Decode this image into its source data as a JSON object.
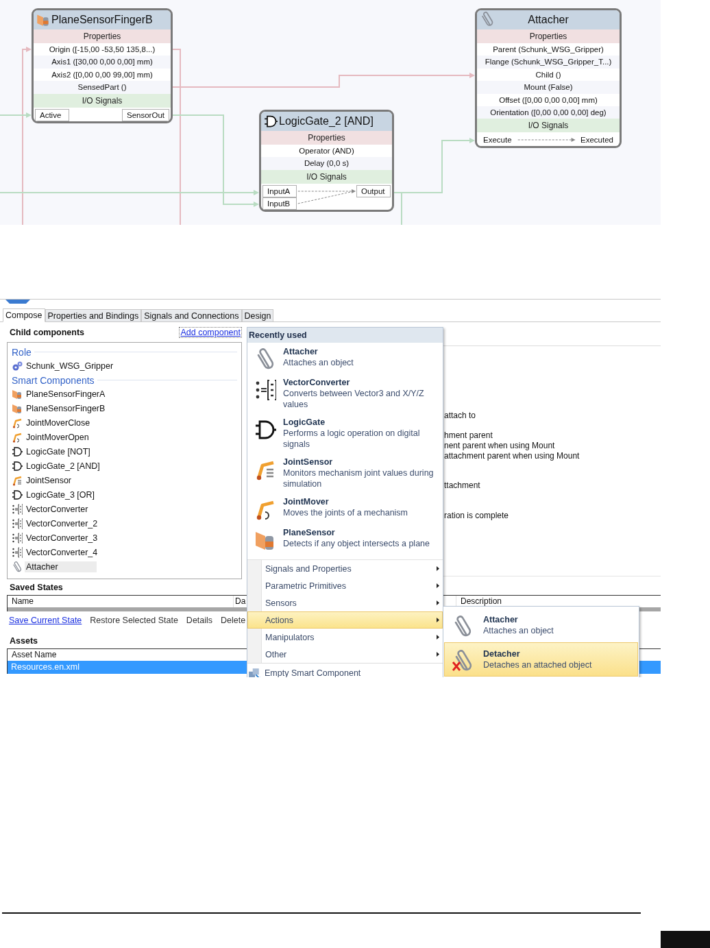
{
  "diagram": {
    "nodes": [
      {
        "kind": "planesensor",
        "title": "PlaneSensorFingerB",
        "properties_heading": "Properties",
        "properties": [
          "Origin ([-15,00 -53,50 135,8...)",
          "Axis1 ([30,00 0,00 0,00] mm)",
          "Axis2 ([0,00 0,00 99,00] mm)",
          "SensedPart ()"
        ],
        "signals_heading": "I/O Signals",
        "inputs": [
          "Active"
        ],
        "outputs": [
          "SensorOut"
        ],
        "linked": false
      },
      {
        "kind": "logicgate",
        "title": "LogicGate_2 [AND]",
        "properties_heading": "Properties",
        "properties": [
          "Operator (AND)",
          "Delay (0,0 s)"
        ],
        "signals_heading": "I/O Signals",
        "inputs": [
          "InputA",
          "InputB"
        ],
        "outputs": [
          "Output"
        ],
        "linked": true
      },
      {
        "kind": "attacher",
        "title": "Attacher",
        "properties_heading": "Properties",
        "properties": [
          "Parent (Schunk_WSG_Gripper)",
          "Flange (Schunk_WSG_Gripper_T...)",
          "Child ()",
          "Mount (False)",
          "Offset ([0,00 0,00 0,00] mm)",
          "Orientation ([0,00 0,00 0,00] deg)"
        ],
        "signals_heading": "I/O Signals",
        "inputs": [
          "Execute"
        ],
        "outputs": [
          "Executed"
        ],
        "linked": true
      }
    ]
  },
  "editor": {
    "tabs": [
      {
        "label": "Compose",
        "selected": true
      },
      {
        "label": "Properties and Bindings",
        "selected": false
      },
      {
        "label": "Signals and Connections",
        "selected": false
      },
      {
        "label": "Design",
        "selected": false
      }
    ],
    "child_components": {
      "title": "Child components",
      "add_link": "Add component",
      "groups": [
        {
          "heading": "Role",
          "items": [
            {
              "kind": "gear",
              "label": "Schunk_WSG_Gripper",
              "selected": false
            }
          ]
        },
        {
          "heading": "Smart Components",
          "items": [
            {
              "kind": "planesensor",
              "label": "PlaneSensorFingerA",
              "selected": false
            },
            {
              "kind": "planesensor",
              "label": "PlaneSensorFingerB",
              "selected": false
            },
            {
              "kind": "jointmover",
              "label": "JointMoverClose",
              "selected": false
            },
            {
              "kind": "jointmover",
              "label": "JointMoverOpen",
              "selected": false
            },
            {
              "kind": "logicgate",
              "label": "LogicGate [NOT]",
              "selected": false
            },
            {
              "kind": "logicgate",
              "label": "LogicGate_2 [AND]",
              "selected": false
            },
            {
              "kind": "jointsensor",
              "label": "JointSensor",
              "selected": false
            },
            {
              "kind": "logicgate",
              "label": "LogicGate_3 [OR]",
              "selected": false
            },
            {
              "kind": "vectorconverter",
              "label": "VectorConverter",
              "selected": false
            },
            {
              "kind": "vectorconverter",
              "label": "VectorConverter_2",
              "selected": false
            },
            {
              "kind": "vectorconverter",
              "label": "VectorConverter_3",
              "selected": false
            },
            {
              "kind": "vectorconverter",
              "label": "VectorConverter_4",
              "selected": false
            },
            {
              "kind": "attacher",
              "label": "Attacher",
              "selected": true
            }
          ]
        }
      ]
    },
    "background_text": [
      "attach to",
      "hment parent",
      "nent parent when using Mount",
      "attachment parent when using Mount",
      "ttachment",
      "ration is complete"
    ],
    "saved_states": {
      "title": "Saved States",
      "columns": [
        "Name",
        "Da",
        "Description"
      ],
      "actions": [
        {
          "kind": "link",
          "label": "Save Current State"
        },
        {
          "kind": "action",
          "label": "Restore Selected State"
        },
        {
          "kind": "action",
          "label": "Details"
        },
        {
          "kind": "action",
          "label": "Delete"
        }
      ]
    },
    "assets": {
      "title": "Assets",
      "columns": [
        "Asset Name"
      ],
      "rows": [
        {
          "name": "Resources.en.xml",
          "selected": true
        }
      ]
    }
  },
  "add_menu": {
    "heading": "Recently used",
    "recent": [
      {
        "kind": "attacher",
        "title": "Attacher",
        "description": "Attaches an object"
      },
      {
        "kind": "vectorconverter",
        "title": "VectorConverter",
        "description": "Converts between Vector3 and X/Y/Z values"
      },
      {
        "kind": "logicgate",
        "title": "LogicGate",
        "description": "Performs a logic operation on digital signals"
      },
      {
        "kind": "jointsensor",
        "title": "JointSensor",
        "description": "Monitors mechanism joint values during simulation"
      },
      {
        "kind": "jointmover",
        "title": "JointMover",
        "description": "Moves the joints of a mechanism"
      },
      {
        "kind": "planesensor",
        "title": "PlaneSensor",
        "description": "Detects if any object intersects a plane"
      }
    ],
    "categories": [
      {
        "label": "Signals and Properties",
        "selected": false
      },
      {
        "label": "Parametric Primitives",
        "selected": false
      },
      {
        "label": "Sensors",
        "selected": false
      },
      {
        "label": "Actions",
        "selected": true
      },
      {
        "label": "Manipulators",
        "selected": false
      },
      {
        "label": "Other",
        "selected": false
      }
    ],
    "footer": {
      "label": "Empty Smart Component"
    }
  },
  "submenu": {
    "items": [
      {
        "kind": "attacher",
        "title": "Attacher",
        "description": "Attaches an object",
        "selected": false
      },
      {
        "kind": "detacher",
        "title": "Detacher",
        "description": "Detaches an attached object",
        "selected": true
      }
    ]
  }
}
